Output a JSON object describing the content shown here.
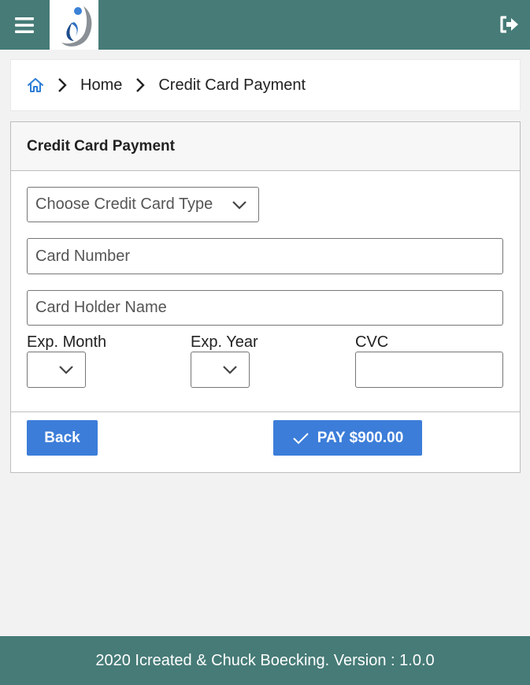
{
  "colors": {
    "header_bg": "#467b77",
    "accent": "#3c7dd9",
    "page_bg": "#f2f2f2"
  },
  "header": {
    "menu_icon": "hamburger-menu-icon",
    "logo_icon": "company-logo",
    "logout_icon": "sign-out-icon"
  },
  "breadcrumb": {
    "home_icon": "home-icon",
    "items": [
      "Home",
      "Credit Card Payment"
    ]
  },
  "card": {
    "title": "Credit Card Payment",
    "card_type_placeholder": "Choose Credit Card Type",
    "card_number_placeholder": "Card Number",
    "card_holder_placeholder": "Card Holder Name",
    "exp_month_label": "Exp. Month",
    "exp_year_label": "Exp. Year",
    "cvc_label": "CVC",
    "exp_month_value": "",
    "exp_year_value": "",
    "cvc_value": ""
  },
  "actions": {
    "back_label": "Back",
    "pay_label": "PAY $900.00",
    "pay_icon": "checkmark-icon"
  },
  "footer": {
    "text": "2020 Icreated & Chuck Boecking. Version : 1.0.0"
  }
}
